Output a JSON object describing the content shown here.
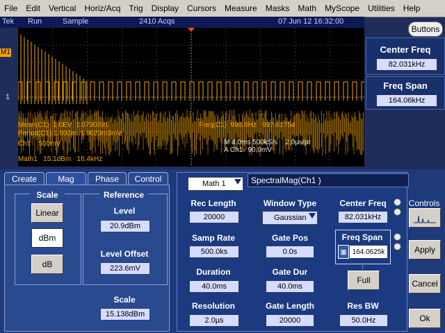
{
  "menu": [
    "File",
    "Edit",
    "Vertical",
    "Horiz/Acq",
    "Trig",
    "Display",
    "Cursors",
    "Measure",
    "Masks",
    "Math",
    "MyScope",
    "Utilities",
    "Help"
  ],
  "status": {
    "brand": "Tek",
    "run": "Run",
    "mode": "Sample",
    "acqs": "2410 Acqs",
    "datetime": "07 Jun 12 16:32:00"
  },
  "buttons_label": "Buttons",
  "scope": {
    "m1_label": "M1",
    "ch1_label": "1",
    "readout": {
      "mean_label": "Mean(C1)",
      "mean_val": "1.0EV",
      "mean_val2": "1.0790091",
      "period_label": "Period(C1)",
      "period_val": "1.002ns",
      "period_val2": "1.0023m3mV",
      "freq_label": "Freq(C1)",
      "freq_val": "998.0Hz",
      "freq_val2": "997.61754",
      "ch1": "Ch1",
      "ch1_scale": "500mV",
      "timebase": "M 4.0ms 500kS/s",
      "tb_res": "2.0µs/pt",
      "trig": "A  Ch1  ⁄  90.0mV",
      "math1": "Math1",
      "math1_scale": "15.1dBm",
      "math1_freq": "16.4kHz"
    }
  },
  "right_panel": {
    "center_freq_title": "Center Freq",
    "center_freq_val": "82.031kHz",
    "freq_span_title": "Freq Span",
    "freq_span_val": "164.06kHz"
  },
  "tabs": [
    "Create",
    "Mag",
    "Phase",
    "Control"
  ],
  "scale": {
    "title": "Scale",
    "linear": "Linear",
    "dbm": "dBm",
    "db": "dB"
  },
  "reference": {
    "title": "Reference",
    "level_label": "Level",
    "level_val": "20.9dBm",
    "offset_label": "Level Offset",
    "offset_val": "223.6mV"
  },
  "scale_val": {
    "label": "Scale",
    "val": "15.138dBm"
  },
  "math": {
    "select": "Math 1",
    "spectral_title": "SpectralMag(Ch1 )",
    "rec_length_label": "Rec Length",
    "rec_length_val": "20000",
    "samp_rate_label": "Samp Rate",
    "samp_rate_val": "500.0ks",
    "duration_label": "Duration",
    "duration_val": "40.0ms",
    "resolution_label": "Resolution",
    "resolution_val": "2.0µs",
    "window_label": "Window Type",
    "window_val": "Gaussian",
    "gate_pos_label": "Gate Pos",
    "gate_pos_val": "0.0s",
    "gate_dur_label": "Gate Dur",
    "gate_dur_val": "40.0ms",
    "gate_len_label": "Gate Length",
    "gate_len_val": "20000",
    "center_label": "Center Freq",
    "center_val": "82.031kHz",
    "span_label": "Freq Span",
    "span_val": "164.0625k",
    "full_label": "Full",
    "resbw_label": "Res BW",
    "resbw_val": "50.0Hz"
  },
  "controls": {
    "title": "Controls",
    "apply": "Apply",
    "cancel": "Cancel",
    "ok": "Ok"
  },
  "colors": {
    "ch1": "#f3a20a",
    "math": "#f6a800",
    "grid": "#5a5a5a"
  }
}
